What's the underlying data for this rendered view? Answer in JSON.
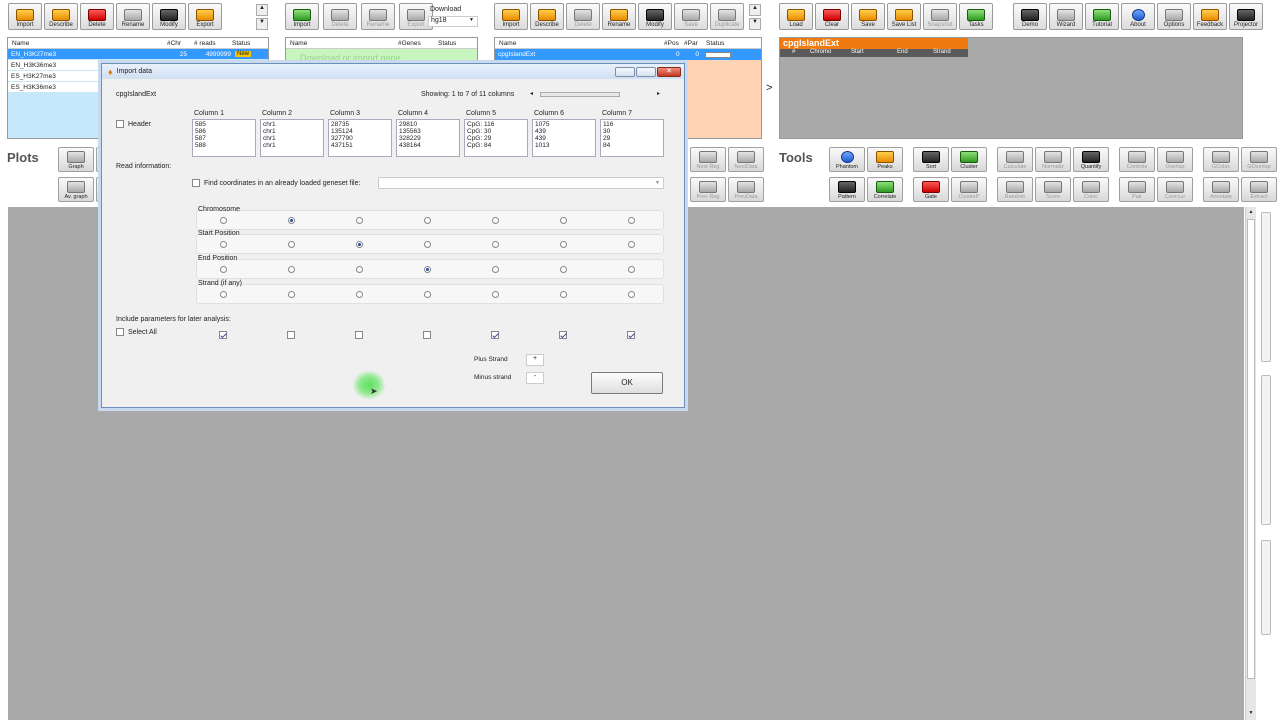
{
  "toolbar_reads": {
    "buttons": [
      "Import",
      "Describe",
      "Delete",
      "Rename",
      "Modify",
      "Export"
    ]
  },
  "toolbar_genes": {
    "buttons": [
      "Import",
      "Delete",
      "Rename",
      "Export"
    ],
    "download_label": "Download",
    "genome": "hg18"
  },
  "toolbar_regions": {
    "buttons": [
      "Import",
      "Describe",
      "Delete",
      "Rename",
      "Modify",
      "Save",
      "Duplicate"
    ]
  },
  "toolbar_main": {
    "buttons": [
      "Load",
      "Clear",
      "Save",
      "Save List",
      "Snapshot",
      "Tasks",
      "Demo",
      "Wizard",
      "Tutorial",
      "About",
      "Options",
      "Feedback",
      "Projector"
    ]
  },
  "reads_panel": {
    "headers": [
      "Name",
      "#Chr",
      "# reads",
      "Status"
    ],
    "rows": [
      {
        "name": "EN_H3K27me3",
        "chr": "25",
        "reads": "4999999",
        "status": "New"
      },
      {
        "name": "EN_H3K36me3",
        "chr": "",
        "reads": "",
        "status": ""
      },
      {
        "name": "ES_H3K27me3",
        "chr": "",
        "reads": "",
        "status": ""
      },
      {
        "name": "ES_H3K36me3",
        "chr": "",
        "reads": "",
        "status": ""
      }
    ]
  },
  "genes_panel": {
    "headers": [
      "Name",
      "#Genes",
      "Status"
    ],
    "placeholder": "Download or import gene..."
  },
  "regions_panel": {
    "headers": [
      "Name",
      "#Pos",
      "#Par",
      "Status"
    ],
    "rows": [
      {
        "name": "cpgIslandExt",
        "pos": "0",
        "par": "0"
      }
    ]
  },
  "details_panel": {
    "title": "cpgIslandExt",
    "headers": [
      "#",
      "Chromo",
      "Start",
      "End",
      "Strand"
    ]
  },
  "arrow_label": ">",
  "plots": {
    "label": "Plots",
    "buttons_row1": [
      "Graph",
      "D"
    ],
    "buttons_row2": [
      "Av. graph",
      "D"
    ],
    "nav_row1": [
      "Next Reg",
      "NextData"
    ],
    "nav_row2": [
      "Prev Reg",
      "PrevData"
    ]
  },
  "tools": {
    "label": "Tools",
    "row1": [
      "Phantom",
      "Peaks",
      "Sort",
      "Cluster",
      "Calculate",
      "Normaliz",
      "Quantify",
      "Controls",
      "Overlap",
      "GColoc",
      "GOverlap"
    ],
    "row2": [
      "Pattern",
      "Correlate",
      "Gate",
      "ClusterP",
      "Random",
      "Score",
      "Coloc",
      "Pair",
      "Cooccur",
      "Annotate",
      "Extract"
    ]
  },
  "dialog": {
    "title": "Import data",
    "dataset": "cpgIslandExt",
    "showing": "Showing: 1 to 7 of 11 columns",
    "header_label": "Header",
    "read_info_label": "Read information:",
    "find_coords_label": "Find coordinates in an already loaded geneset file:",
    "columns": [
      {
        "label": "Column 1",
        "values": "585\n586\n587\n588"
      },
      {
        "label": "Column 2",
        "values": "chr1\nchr1\nchr1\nchr1"
      },
      {
        "label": "Column 3",
        "values": "28735\n135124\n327790\n437151"
      },
      {
        "label": "Column 4",
        "values": "29810\n135563\n328229\n438164"
      },
      {
        "label": "Column 5",
        "values": "CpG: 116\nCpG: 30\nCpG: 29\nCpG: 84"
      },
      {
        "label": "Column 6",
        "values": "1075\n439\n439\n1013"
      },
      {
        "label": "Column 7",
        "values": "116\n30\n29\n84"
      }
    ],
    "roles": [
      "Chromosome",
      "Start Position",
      "End Position",
      "Strand (if any)"
    ],
    "role_selected_column": [
      2,
      3,
      4,
      null
    ],
    "include_label": "Include parameters for later analysis:",
    "select_all_label": "Select All",
    "include_checked": [
      true,
      false,
      false,
      false,
      true,
      true,
      true
    ],
    "plus_strand_label": "Plus Strand",
    "plus_strand_value": "+",
    "minus_strand_label": "Minus strand",
    "minus_strand_value": "-",
    "ok_label": "OK"
  }
}
